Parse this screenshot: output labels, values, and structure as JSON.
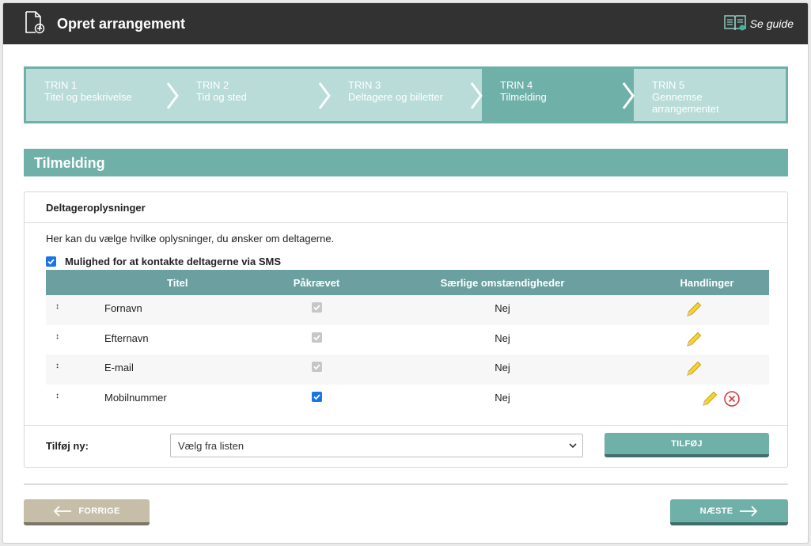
{
  "header": {
    "title": "Opret arrangement",
    "guide_label": "Se guide"
  },
  "steps": [
    {
      "num": "TRIN 1",
      "label": "Titel og beskrivelse",
      "active": false
    },
    {
      "num": "TRIN 2",
      "label": "Tid og sted",
      "active": false
    },
    {
      "num": "TRIN 3",
      "label": "Deltagere og billetter",
      "active": false
    },
    {
      "num": "TRIN 4",
      "label": "Tilmelding",
      "active": true
    },
    {
      "num": "TRIN 5",
      "label": "Gennemse arrangementet",
      "active": false
    }
  ],
  "section": {
    "title": "Tilmelding"
  },
  "panel": {
    "heading": "Deltageroplysninger",
    "intro": "Her kan du vælge hvilke oplysninger, du ønsker om deltagerne.",
    "sms_label": "Mulighed for at kontakte deltagerne via SMS",
    "sms_checked": true
  },
  "table": {
    "headers": {
      "title": "Titel",
      "required": "Påkrævet",
      "special": "Særlige omstændigheder",
      "actions": "Handlinger"
    },
    "rows": [
      {
        "title": "Fornavn",
        "required": true,
        "locked": true,
        "special": "Nej",
        "deletable": false
      },
      {
        "title": "Efternavn",
        "required": true,
        "locked": true,
        "special": "Nej",
        "deletable": false
      },
      {
        "title": "E-mail",
        "required": true,
        "locked": true,
        "special": "Nej",
        "deletable": false
      },
      {
        "title": "Mobilnummer",
        "required": true,
        "locked": false,
        "special": "Nej",
        "deletable": true
      }
    ]
  },
  "add": {
    "label": "Tilføj ny:",
    "select_value": "Vælg fra listen",
    "button": "TILFØJ"
  },
  "nav": {
    "prev": "FORRIGE",
    "next": "NÆSTE"
  },
  "colors": {
    "accent": "#6fb0a8",
    "header_bg": "#323232",
    "prev_btn": "#c6bea8",
    "table_head": "#6b9fa0"
  },
  "icons": {
    "doc": "document-plus-icon",
    "guide": "book-guide-icon",
    "edit": "pencil-icon",
    "delete": "circle-x-icon",
    "drag": "drag-handle-icon"
  }
}
